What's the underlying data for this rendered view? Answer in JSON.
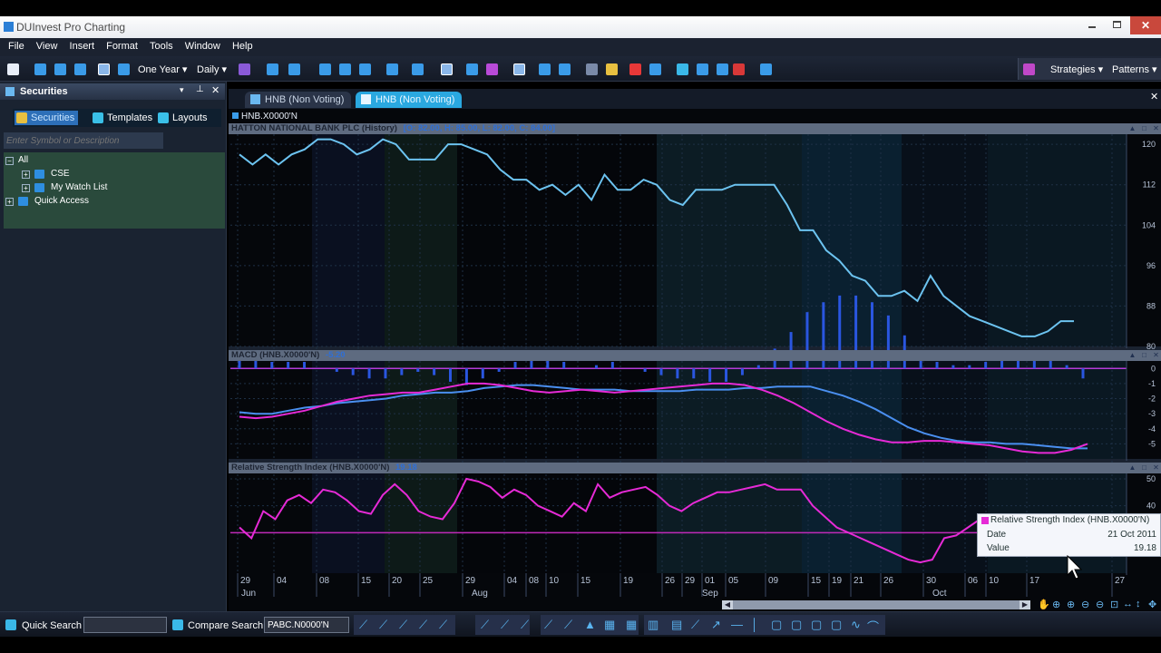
{
  "window": {
    "title": "DUInvest Pro Charting"
  },
  "menu": [
    "File",
    "View",
    "Insert",
    "Format",
    "Tools",
    "Window",
    "Help"
  ],
  "toolbar": {
    "period": "One Year",
    "interval": "Daily",
    "strategies": "Strategies",
    "patterns": "Patterns"
  },
  "left_panel": {
    "title": "Securities",
    "tabs": [
      "Securities",
      "Templates",
      "Layouts"
    ],
    "search_placeholder": "Enter Symbol or Description",
    "tree": {
      "root": "All",
      "children": [
        "CSE",
        "My Watch List"
      ],
      "quick_access": "Quick Access"
    }
  },
  "doc_tabs": [
    "HNB (Non Voting)",
    "HNB (Non Voting)"
  ],
  "symbol": "HNB.X0000'N",
  "panes": {
    "price": {
      "title": "HATTON NATIONAL BANK PLC (History)",
      "ohlc": "[O: 82.00, H: 85.00, L: 82.00, C: 84.00]"
    },
    "macd": {
      "title": "MACD (HNB.X0000'N)",
      "value": "-5.20"
    },
    "rsi": {
      "title": "Relative Strength Index (HNB.X0000'N)",
      "value": "19.18"
    }
  },
  "x_axis": {
    "days": [
      "29",
      "04",
      "08",
      "15",
      "20",
      "25",
      "29",
      "04",
      "08",
      "10",
      "15",
      "19",
      "26",
      "29",
      "01",
      "05",
      "09",
      "15",
      "19",
      "21",
      "26",
      "30",
      "06",
      "10",
      "17",
      "27"
    ],
    "months": [
      "Jun",
      "Aug",
      "Sep",
      "Oct"
    ]
  },
  "tooltip": {
    "title": "Relative Strength Index (HNB.X0000'N)",
    "date_label": "Date",
    "date_value": "21 Oct 2011",
    "value_label": "Value",
    "value": "19.18"
  },
  "bottom_bar": {
    "quick_search_label": "Quick Search",
    "quick_search_value": "",
    "compare_search_label": "Compare Search",
    "compare_search_value": "PABC.N0000'N"
  },
  "colors": {
    "price_line": "#6cc3f0",
    "macd_line": "#4a8ff0",
    "signal_line": "#e62ad6",
    "rsi_line": "#e62ad6",
    "bg": "#05070b"
  },
  "chart_data": [
    {
      "type": "line",
      "title": "HATTON NATIONAL BANK PLC (History)",
      "ylim": [
        80,
        122
      ],
      "yticks": [
        80,
        88,
        96,
        104,
        112,
        120
      ],
      "series": [
        {
          "values": [
            118,
            116,
            118,
            116,
            118,
            119,
            121,
            121,
            120,
            118,
            119,
            121,
            120,
            117,
            117,
            117,
            120,
            120,
            119,
            118,
            115,
            113,
            113,
            111,
            112,
            110,
            112,
            109,
            114,
            111,
            111,
            113,
            112,
            109,
            108,
            111,
            111,
            111,
            112,
            112,
            112,
            112,
            108,
            103,
            103,
            99,
            97,
            94,
            93,
            90,
            90,
            91,
            89,
            94,
            90,
            88,
            86,
            85,
            84,
            83,
            82,
            82,
            83,
            85,
            85
          ]
        }
      ]
    },
    {
      "type": "line",
      "title": "MACD (HNB.X0000'N)",
      "ylim": [
        -6,
        0.5
      ],
      "yticks": [
        0,
        -1,
        -2,
        -3,
        -4,
        -5
      ],
      "series": [
        {
          "name": "MACD",
          "values": [
            -2.9,
            -3.0,
            -3.0,
            -2.8,
            -2.6,
            -2.5,
            -2.3,
            -2.2,
            -2.1,
            -2.0,
            -1.8,
            -1.7,
            -1.6,
            -1.6,
            -1.5,
            -1.3,
            -1.2,
            -1.1,
            -1.1,
            -1.2,
            -1.3,
            -1.4,
            -1.4,
            -1.4,
            -1.5,
            -1.5,
            -1.5,
            -1.5,
            -1.4,
            -1.4,
            -1.4,
            -1.3,
            -1.3,
            -1.2,
            -1.2,
            -1.2,
            -1.5,
            -1.8,
            -2.2,
            -2.7,
            -3.3,
            -3.9,
            -4.3,
            -4.6,
            -4.8,
            -4.9,
            -4.9,
            -5.0,
            -5.0,
            -5.1,
            -5.2,
            -5.3,
            -5.3
          ]
        },
        {
          "name": "Signal",
          "values": [
            -3.2,
            -3.3,
            -3.2,
            -3.0,
            -2.8,
            -2.5,
            -2.2,
            -2.0,
            -1.8,
            -1.7,
            -1.6,
            -1.6,
            -1.4,
            -1.2,
            -1.0,
            -1.0,
            -1.1,
            -1.3,
            -1.5,
            -1.6,
            -1.5,
            -1.4,
            -1.5,
            -1.6,
            -1.5,
            -1.4,
            -1.3,
            -1.2,
            -1.1,
            -1.0,
            -1.0,
            -1.1,
            -1.4,
            -1.8,
            -2.3,
            -2.9,
            -3.5,
            -4.0,
            -4.4,
            -4.7,
            -4.9,
            -4.9,
            -4.8,
            -4.8,
            -4.9,
            -5.0,
            -5.1,
            -5.3,
            -5.5,
            -5.6,
            -5.6,
            -5.4,
            -5.0
          ]
        }
      ]
    },
    {
      "type": "line",
      "title": "Relative Strength Index (HNB.X0000'N)",
      "ylim": [
        15,
        52
      ],
      "yticks": [
        50,
        40
      ],
      "series": [
        {
          "values": [
            32,
            28,
            38,
            35,
            42,
            44,
            41,
            46,
            45,
            42,
            38,
            37,
            44,
            48,
            44,
            38,
            36,
            35,
            41,
            50,
            49,
            47,
            43,
            46,
            44,
            40,
            38,
            36,
            41,
            38,
            48,
            43,
            45,
            46,
            47,
            44,
            40,
            38,
            41,
            43,
            45,
            45,
            46,
            47,
            48,
            46,
            46,
            46,
            40,
            36,
            32,
            30,
            28,
            26,
            24,
            22,
            20,
            19,
            20,
            28,
            29,
            32,
            35,
            34,
            33,
            30,
            27,
            26,
            30,
            29,
            29,
            28
          ]
        }
      ]
    }
  ]
}
